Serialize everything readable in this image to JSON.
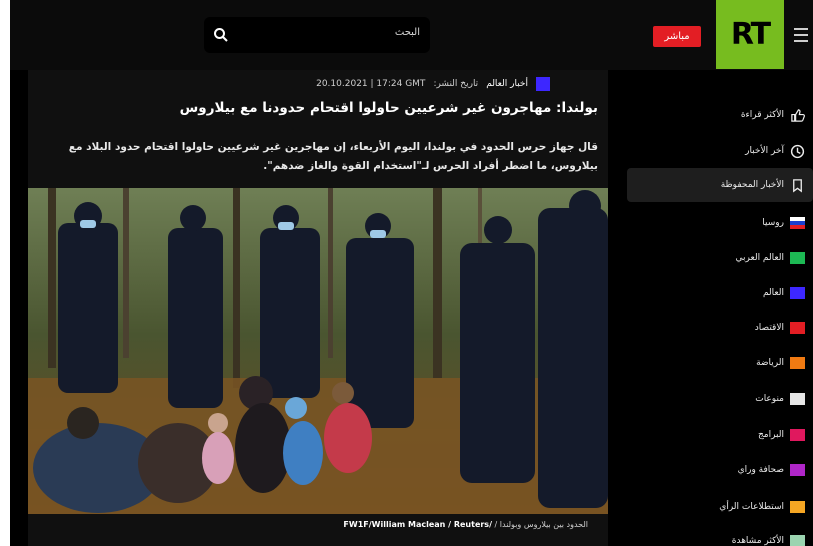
{
  "header": {
    "search_placeholder": "البحث",
    "live_label": "مباشر",
    "logo_text": "RT",
    "logo_color": "#77bc1f",
    "live_color": "#e31e24"
  },
  "article": {
    "category": "أخبار العالم",
    "category_color": "#3d27ff",
    "publish_label": "تاريخ النشر:",
    "publish_datetime": "20.10.2021 | 17:24 GMT",
    "title": "بولندا: مهاجرون غير شرعيين حاولوا اقتحام حدودنا مع بيلاروس",
    "lead": "قال جهاز حرس الحدود في بولندا، اليوم الأربعاء، إن مهاجرين غير شرعيين حاولوا اقتحام حدود البلاد مع بيلاروس، ما اضطر أفراد الحرس لـ\"استخدام القوة والغاز ضدهم\".",
    "photo_caption_prefix": "الحدود بين بيلاروس وبولندا /",
    "photo_caption_credit": "FW1F/William Maclean / Reuters/"
  },
  "sidebar": {
    "items": [
      {
        "label": "الأكثر قراءة",
        "icon": "thumbs-up-icon"
      },
      {
        "label": "آخر الأخبار",
        "icon": "clock-icon"
      },
      {
        "label": "الأخبار المحفوظة",
        "icon": "bookmark-icon"
      },
      {
        "label": "روسيا",
        "icon": "russia-flag-icon"
      },
      {
        "label": "العالم العربي",
        "color": "#1db954"
      },
      {
        "label": "العالم",
        "color": "#3d27ff"
      },
      {
        "label": "الاقتصاد",
        "color": "#e31e24"
      },
      {
        "label": "الرياضة",
        "color": "#f07a12"
      },
      {
        "label": "منوعات",
        "color": "#e6e6e6"
      },
      {
        "label": "البرامج",
        "color": "#e0185e"
      },
      {
        "label": "صحافة وراي",
        "color": "#b026c9"
      },
      {
        "label": "استطلاعات الرأي",
        "color": "#f5a623"
      },
      {
        "label": "الأكثر مشاهدة",
        "color": "#9bd4b0"
      }
    ]
  }
}
